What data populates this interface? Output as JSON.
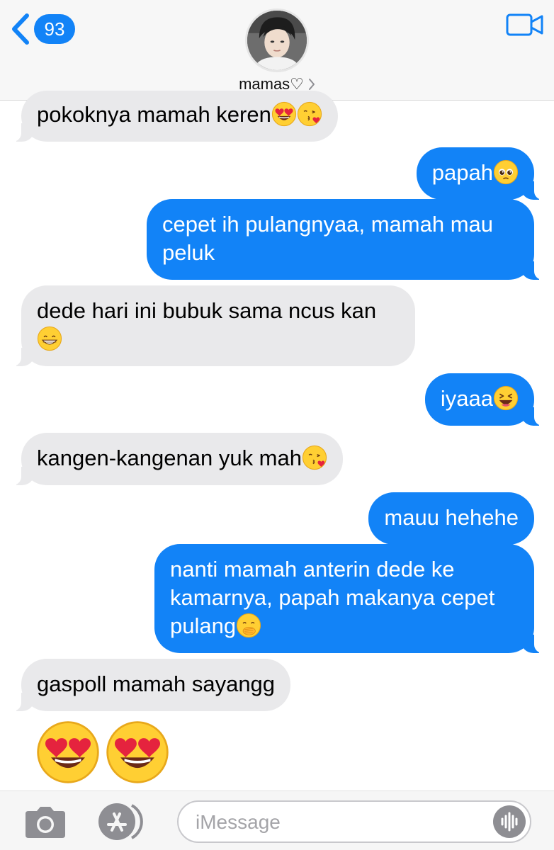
{
  "header": {
    "back_count": "93",
    "contact_name": "mamas♡",
    "icons": {
      "back": "chevron-left-icon",
      "contact_arrow": "chevron-right-icon",
      "video": "video-camera-icon"
    }
  },
  "messages": [
    {
      "dir": "in",
      "text": "pokoknya mamah keren",
      "emojis": [
        "heart-eyes",
        "kiss"
      ]
    },
    {
      "dir": "out",
      "text": "papah",
      "emojis": [
        "pleading"
      ]
    },
    {
      "dir": "out",
      "text": "cepet ih pulangnyaa, mamah mau\npeluk",
      "emojis": []
    },
    {
      "dir": "in",
      "text": "dede hari ini bubuk sama ncus kan\n",
      "emojis": [
        "grin"
      ]
    },
    {
      "dir": "out",
      "text": "iyaaa",
      "emojis": [
        "laughing"
      ]
    },
    {
      "dir": "in",
      "text": "kangen-kangenan yuk mah",
      "emojis": [
        "kiss"
      ]
    },
    {
      "dir": "out",
      "text": "mauu hehehe",
      "emojis": []
    },
    {
      "dir": "out",
      "text": "nanti mamah anterin dede ke\nkamarnya, papah makanya cepet\npulang",
      "emojis": [
        "hand-over-mouth"
      ]
    },
    {
      "dir": "in",
      "text": "gaspoll mamah sayangg",
      "emojis": []
    }
  ],
  "standalone_emojis": [
    "heart-eyes",
    "heart-eyes"
  ],
  "composer": {
    "placeholder": "iMessage",
    "icons": {
      "camera": "camera-icon",
      "apps": "app-store-icon",
      "audio": "audio-waveform-icon"
    }
  },
  "colors": {
    "accent_blue": "#1283f7",
    "incoming_bubble": "#e9e9eb",
    "header_bg": "#f7f7f7"
  }
}
